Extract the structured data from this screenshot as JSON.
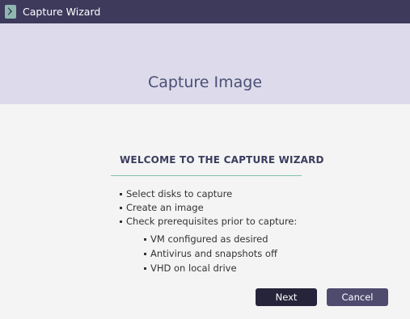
{
  "window": {
    "title": "Capture Wizard"
  },
  "banner": {
    "title": "Capture Image"
  },
  "welcome": {
    "heading": "WELCOME TO THE CAPTURE WIZARD",
    "steps": [
      "Select disks to capture",
      "Create an image",
      "Check prerequisites prior to capture:"
    ],
    "prerequisites": [
      "VM configured as desired",
      "Antivirus and snapshots off",
      "VHD on local drive"
    ]
  },
  "buttons": {
    "next": "Next",
    "cancel": "Cancel"
  },
  "colors": {
    "titlebar": "#3d3a5c",
    "banner": "#dddbeb",
    "accent_line": "#7fc1ab",
    "next_button": "#25243a",
    "cancel_button": "#4e4b6f"
  }
}
